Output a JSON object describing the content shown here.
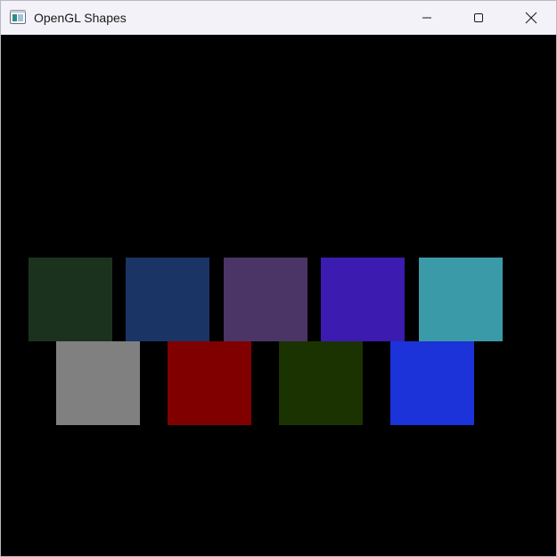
{
  "window": {
    "title": "OpenGL Shapes",
    "icon": "opengl-app-icon"
  },
  "caption_buttons": {
    "minimize_icon": "minimize-icon",
    "maximize_icon": "maximize-icon",
    "close_icon": "close-icon"
  },
  "canvas": {
    "background": "#000000",
    "row1": [
      {
        "color": "#1b331e"
      },
      {
        "color": "#1b3466"
      },
      {
        "color": "#4b3466"
      },
      {
        "color": "#3b1bb0"
      },
      {
        "color": "#3b9aa8"
      }
    ],
    "row2": [
      {
        "color": "#808080"
      },
      {
        "color": "#800000"
      },
      {
        "color": "#1b3300"
      },
      {
        "color": "#1b33d8"
      }
    ]
  }
}
